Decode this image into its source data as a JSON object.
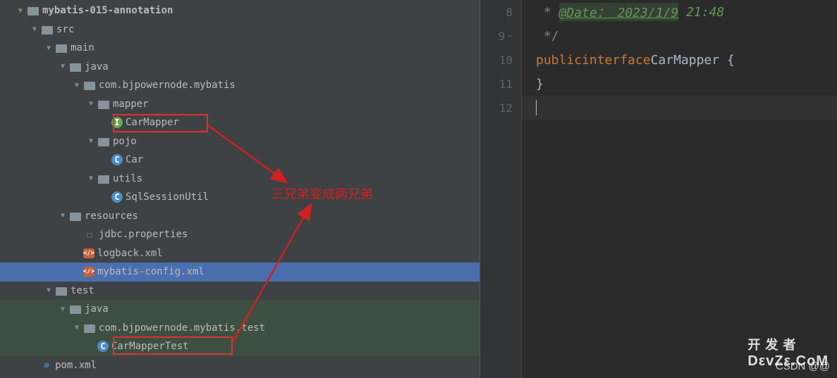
{
  "tree": {
    "root": "mybatis-015-annotation",
    "src": "src",
    "main": "main",
    "java_main": "java",
    "pkg_main": "com.bjpowernode.mybatis",
    "mapper": "mapper",
    "car_mapper": "CarMapper",
    "pojo": "pojo",
    "car": "Car",
    "utils": "utils",
    "sql_session_util": "SqlSessionUtil",
    "resources": "resources",
    "jdbc_props": "jdbc.properties",
    "logback_xml": "logback.xml",
    "mybatis_cfg": "mybatis-config.xml",
    "test": "test",
    "java_test": "java",
    "pkg_test": "com.bjpowernode.mybatis.test",
    "car_mapper_test": "CarMapperTest",
    "pom": "pom.xml"
  },
  "annotation": "三兄弟变成两兄弟",
  "editor": {
    "line_numbers": [
      "8",
      "9",
      "10",
      "11",
      "12"
    ],
    "line8_tag": "@Date：",
    "line8_date": "2023/1/9",
    "line8_time": " 21:48",
    "line8_prefix": " * ",
    "line9": " */",
    "line10_kw1": "public",
    "line10_kw2": "interface",
    "line10_cls": "CarMapper",
    "line10_brace": " {",
    "line11": "}"
  },
  "watermark_csdn": "CSDN @@",
  "watermark_logo_top": "开 发 者",
  "watermark_logo_bot": "DεvZε.CοM"
}
